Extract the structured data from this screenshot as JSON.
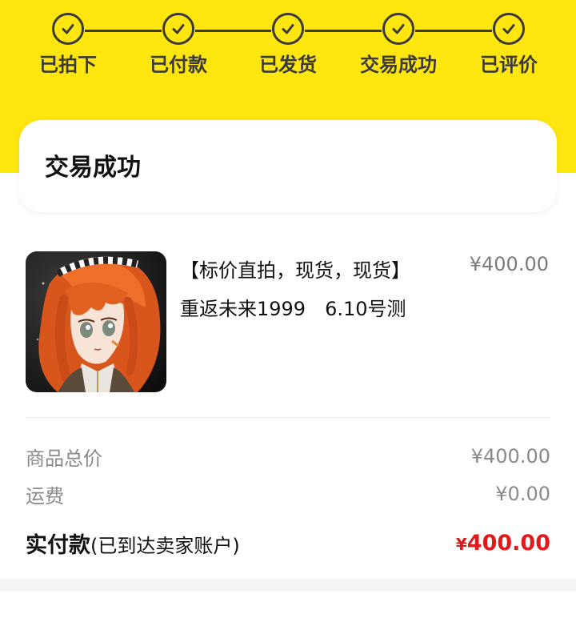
{
  "colors": {
    "accent_yellow": "#FFE60F",
    "step_ink": "#3A3A3A",
    "price_red": "#E0191B"
  },
  "progress": {
    "steps": [
      {
        "label": "已拍下",
        "icon": "check-circle-icon"
      },
      {
        "label": "已付款",
        "icon": "check-circle-icon"
      },
      {
        "label": "已发货",
        "icon": "check-circle-icon"
      },
      {
        "label": "交易成功",
        "icon": "check-circle-icon"
      },
      {
        "label": "已评价",
        "icon": "check-circle-icon"
      }
    ]
  },
  "status": {
    "title": "交易成功"
  },
  "product": {
    "title_line1": "【标价直拍，现货，现货】",
    "title_line2": "重返未来1999　6.10号测",
    "price": "¥400.00",
    "image_alt": "anime-girl-orange-hair-thumbnail"
  },
  "summary": {
    "goods_total_label": "商品总价",
    "goods_total_value": "¥400.00",
    "shipping_label": "运费",
    "shipping_value": "¥0.00",
    "paid_label": "实付款",
    "paid_note": "(已到达卖家账户)",
    "paid_currency": "¥",
    "paid_value": "400.00"
  }
}
